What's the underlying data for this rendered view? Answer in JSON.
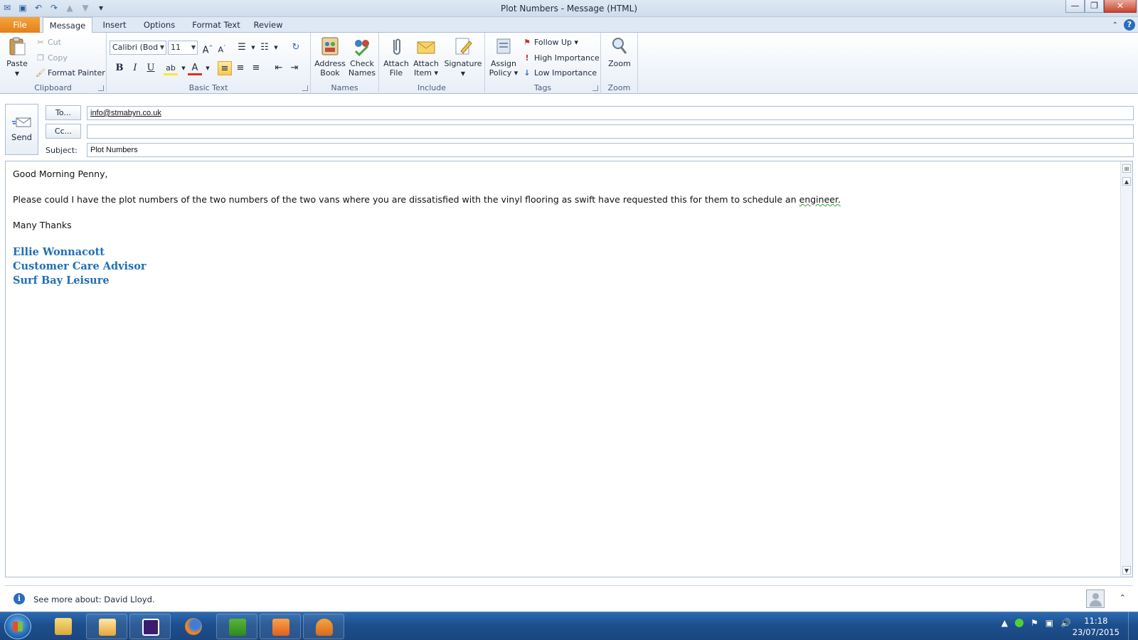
{
  "window": {
    "title": "Plot Numbers  -  Message (HTML)",
    "controls": {
      "minimize": "—",
      "maximize": "❐",
      "close": "✕"
    }
  },
  "tabs": [
    "File",
    "Message",
    "Insert",
    "Options",
    "Format Text",
    "Review"
  ],
  "ribbon": {
    "clipboard": {
      "label": "Clipboard",
      "paste": "Paste",
      "cut": "Cut",
      "copy": "Copy",
      "format_painter": "Format Painter"
    },
    "basic_text": {
      "label": "Basic Text",
      "font": "Calibri (Bod",
      "size": "11",
      "bold": "B",
      "italic": "I",
      "underline": "U"
    },
    "names": {
      "label": "Names",
      "address_book_1": "Address",
      "address_book_2": "Book",
      "check_names_1": "Check",
      "check_names_2": "Names"
    },
    "include": {
      "label": "Include",
      "attach_file_1": "Attach",
      "attach_file_2": "File",
      "attach_item_1": "Attach",
      "attach_item_2": "Item ▾",
      "signature": "Signature"
    },
    "tags": {
      "label": "Tags",
      "assign_policy_1": "Assign",
      "assign_policy_2": "Policy ▾",
      "follow_up": "Follow Up ▾",
      "high": "High Importance",
      "low": "Low Importance"
    },
    "zoom": {
      "label": "Zoom",
      "zoom": "Zoom"
    }
  },
  "header": {
    "send": "Send",
    "to_button": "To...",
    "cc_button": "Cc...",
    "subject_label": "Subject:",
    "to_value": "info@stmabyn.co.uk",
    "cc_value": "",
    "subject_value": "Plot Numbers"
  },
  "body": {
    "greeting": "Good Morning Penny,",
    "para_main": "Please could I have the plot numbers of the two numbers of the two vans where you are dissatisfied with the vinyl flooring as swift have requested this for them to schedule an ",
    "para_end": "engineer.",
    "closing": "Many Thanks",
    "sig_name": "Ellie Wonnacott",
    "sig_title": "Customer Care Advisor",
    "sig_company": "Surf Bay Leisure"
  },
  "people_pane": {
    "text": "See more about: David Lloyd."
  },
  "taskbar": {
    "time": "11:18",
    "date": "23/07/2015"
  },
  "colors": {
    "signature": "#1f6fb3",
    "file_tab": "#e2801a",
    "taskbar": "#1d4f8e"
  }
}
